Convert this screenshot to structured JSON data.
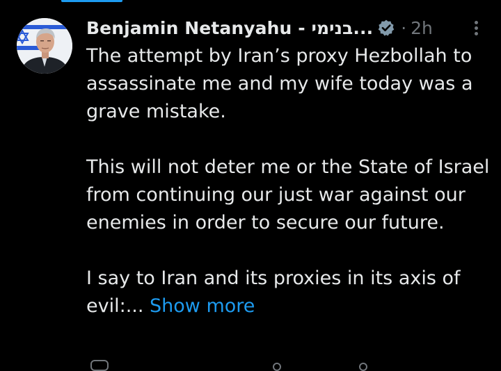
{
  "tweet": {
    "author_name": "Benjamin Netanyahu - בנימי...",
    "separator": "·",
    "time": "2h",
    "paragraphs": [
      "The attempt by Iran’s proxy Hezbollah to assassinate me and my wife today was a grave mistake.",
      "This will not deter me or the State of Israel from continuing our just war against our enemies in order to secure our future."
    ],
    "last_paragraph": "I say to Iran and its proxies in its axis of evil:... ",
    "show_more": "Show more"
  },
  "icons": {
    "avatar": "profile-photo",
    "verified": "verified-badge-icon",
    "more": "more-options-icon"
  },
  "colors": {
    "background": "#000000",
    "text": "#e7e9ea",
    "muted": "#71767b",
    "link": "#1d9bf0"
  }
}
